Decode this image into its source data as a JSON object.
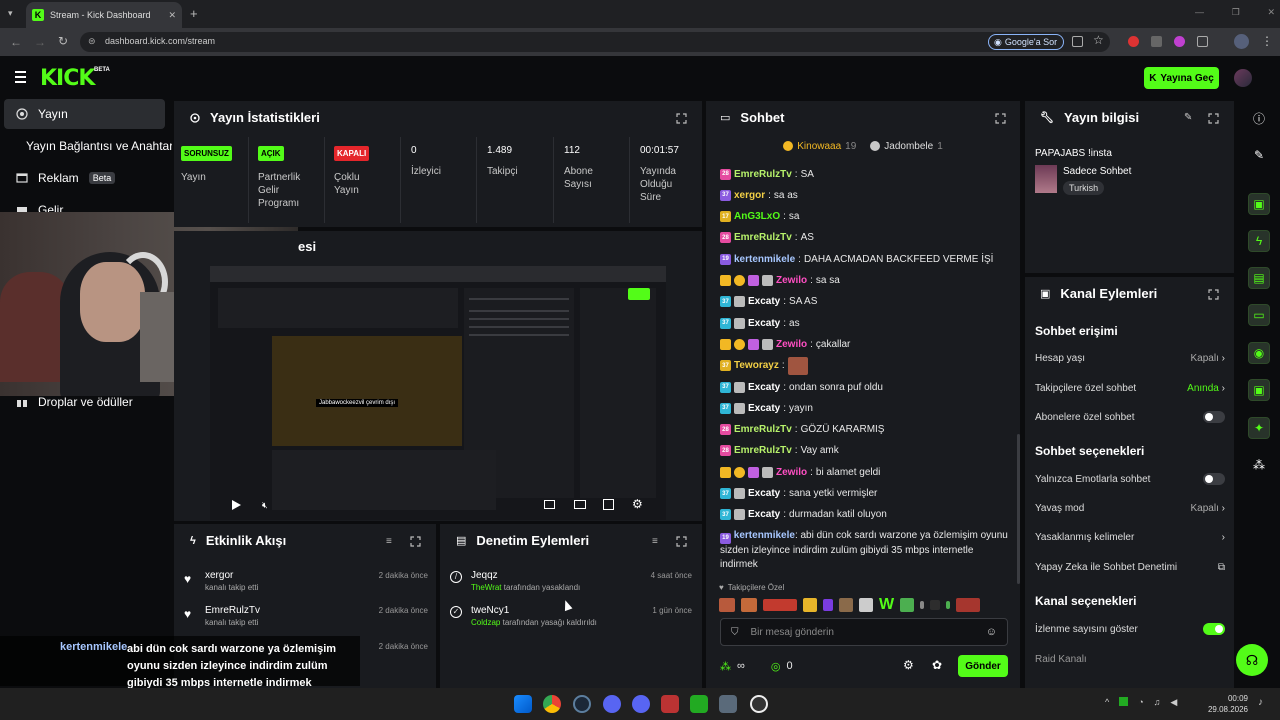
{
  "browser": {
    "tab_title": "Stream - Kick Dashboard",
    "url": "dashboard.kick.com/stream",
    "search_chip": "Google'a Sor"
  },
  "header": {
    "logo": "KICK",
    "logo_badge": "BETA",
    "go_live": "Yayına Geç"
  },
  "sidebar": {
    "items": [
      {
        "label": "Yayın",
        "icon": "broadcast-icon"
      },
      {
        "label": "Yayın Bağlantısı ve Anahtar",
        "icon": "link-icon"
      },
      {
        "label": "Reklam",
        "icon": "ad-icon",
        "badge": "Beta"
      },
      {
        "label": "Gelir",
        "icon": "money-icon"
      },
      {
        "label": "Droplar ve ödüller",
        "icon": "gift-icon"
      }
    ]
  },
  "stats": {
    "title": "Yayın İstatistikleri",
    "items": [
      {
        "badge": "SORUNSUZ",
        "badge_color": "#53fc18",
        "label": "Yayın"
      },
      {
        "badge": "AÇIK",
        "badge_color": "#53fc18",
        "label": "Partnerlik Gelir Programı"
      },
      {
        "badge": "KAPALI",
        "badge_color": "#e5262b",
        "label": "Çoklu Yayın"
      },
      {
        "value": "0",
        "label": "İzleyici"
      },
      {
        "value": "1.489",
        "label": "Takipçi"
      },
      {
        "value": "112",
        "label": "Abone Sayısı"
      },
      {
        "value": "00:01:57",
        "label": "Yayında Olduğu Süre"
      }
    ]
  },
  "preview": {
    "title_suffix": "esi",
    "overlay_caption": "Jabbawockeezvil çevrim dışı"
  },
  "activity": {
    "title": "Etkinlik Akışı",
    "items": [
      {
        "user": "xergor",
        "action": "kanalı takip etti",
        "time": "2 dakika önce"
      },
      {
        "user": "EmreRulzTv",
        "action": "kanalı takip etti",
        "time": "2 dakika önce"
      },
      {
        "user": "",
        "action": "",
        "time": "2 dakika önce"
      }
    ]
  },
  "moderation": {
    "title": "Denetim Eylemleri",
    "items": [
      {
        "user": "Jeqqz",
        "actor": "TheWrat",
        "action": "tarafından yasaklandı",
        "time": "4 saat önce"
      },
      {
        "user": "tweNcy1",
        "actor": "Coldzap",
        "action": "tarafından yasağı kaldırıldı",
        "time": "1 gün önce"
      }
    ]
  },
  "webcam_caption": {
    "user": "kertenmikele",
    "text": "abi dün cok sardı warzone ya özlemişim oyunu sizden izleyince indirdim zulüm gibiydi 35 mbps internetle indirmek"
  },
  "chat": {
    "title": "Sohbet",
    "top_gifters": [
      {
        "name": "Kinowaaa",
        "count": "19"
      },
      {
        "name": "Jadombele",
        "count": "1"
      }
    ],
    "messages": [
      {
        "lv": "28",
        "color": "#e54ba0",
        "user": "EmreRulzTv",
        "ucolor": "#b7f26b",
        "text": "SA"
      },
      {
        "lv": "37",
        "color": "#8a5be0",
        "user": "xergor",
        "ucolor": "#f3d046",
        "text": "sa as"
      },
      {
        "lv": "17",
        "color": "#e0b020",
        "user": "AnG3LxO",
        "ucolor": "#53fc18",
        "text": "sa"
      },
      {
        "lv": "28",
        "color": "#e54ba0",
        "user": "EmreRulzTv",
        "ucolor": "#b7f26b",
        "text": "AS"
      },
      {
        "lv": "19",
        "color": "#8a5be0",
        "user": "kertenmikele",
        "ucolor": "#a7c7ff",
        "text": "DAHA ACMADAN BACKFEED VERME İŞİ"
      },
      {
        "lv": "",
        "color": "",
        "user": "Zewilo",
        "ucolor": "#ff4fc3",
        "text": "sa sa",
        "badges": true
      },
      {
        "lv": "37",
        "color": "#2fb6d6",
        "user": "Excaty",
        "ucolor": "#ffffff",
        "text": "SA AS",
        "mod": true
      },
      {
        "lv": "37",
        "color": "#2fb6d6",
        "user": "Excaty",
        "ucolor": "#ffffff",
        "text": "as",
        "mod": true
      },
      {
        "lv": "",
        "color": "",
        "user": "Zewilo",
        "ucolor": "#ff4fc3",
        "text": "çakallar",
        "badges": true
      },
      {
        "lv": "37",
        "color": "#e0b020",
        "user": "Teworayz",
        "ucolor": "#f3d046",
        "text": "",
        "emote": true
      },
      {
        "lv": "37",
        "color": "#2fb6d6",
        "user": "Excaty",
        "ucolor": "#ffffff",
        "text": "ondan sonra puf oldu",
        "mod": true
      },
      {
        "lv": "37",
        "color": "#2fb6d6",
        "user": "Excaty",
        "ucolor": "#ffffff",
        "text": "yayın",
        "mod": true
      },
      {
        "lv": "28",
        "color": "#e54ba0",
        "user": "EmreRulzTv",
        "ucolor": "#b7f26b",
        "text": "GÖZÜ KARARMIŞ"
      },
      {
        "lv": "28",
        "color": "#e54ba0",
        "user": "EmreRulzTv",
        "ucolor": "#b7f26b",
        "text": "Vay amk"
      },
      {
        "lv": "",
        "color": "",
        "user": "Zewilo",
        "ucolor": "#ff4fc3",
        "text": "bi alamet geldi",
        "badges": true
      },
      {
        "lv": "37",
        "color": "#2fb6d6",
        "user": "Excaty",
        "ucolor": "#ffffff",
        "text": "sana yetki vermişler",
        "mod": true
      },
      {
        "lv": "37",
        "color": "#2fb6d6",
        "user": "Excaty",
        "ucolor": "#ffffff",
        "text": "durmadan katil oluyon",
        "mod": true
      }
    ],
    "last_message": {
      "lv": "19",
      "user": "kertenmikele",
      "text": "abi dün cok sardı warzone ya özlemişim oyunu sizden izleyince indirdim zulüm gibiydi 35 mbps internetle indirmek"
    },
    "emote_bar_label": "Takipçilere Özel",
    "input_placeholder": "Bir mesaj gönderin",
    "footer_left": "∞",
    "footer_points": "0",
    "send": "Gönder"
  },
  "stream_info": {
    "title": "Yayın bilgisi",
    "stream_title": "PAPAJABS !insta",
    "category": "Sadece Sohbet",
    "tag": "Turkish"
  },
  "channel_actions": {
    "title": "Kanal Eylemleri",
    "section_access": "Sohbet erişimi",
    "rows_access": [
      {
        "label": "Hesap yaşı",
        "value": "Kapalı",
        "type": "chevron"
      },
      {
        "label": "Takipçilere özel sohbet",
        "value": "Anında",
        "type": "chevron",
        "value_color": "#53fc18"
      },
      {
        "label": "Abonelere özel sohbet",
        "value": "",
        "type": "toggle",
        "on": false
      }
    ],
    "section_options": "Sohbet seçenekleri",
    "rows_options": [
      {
        "label": "Yalnızca Emotlarla sohbet",
        "value": "",
        "type": "toggle",
        "on": false
      },
      {
        "label": "Yavaş mod",
        "value": "Kapalı",
        "type": "chevron"
      },
      {
        "label": "Yasaklanmış kelimeler",
        "value": "",
        "type": "chevron"
      },
      {
        "label": "Yapay Zeka ile Sohbet Denetimi",
        "value": "",
        "type": "external"
      }
    ],
    "section_channel": "Kanal seçenekleri",
    "rows_channel": [
      {
        "label": "İzlenme sayısını göster",
        "value": "",
        "type": "toggle",
        "on": true
      },
      {
        "label": "Raid Kanalı",
        "value": "",
        "type": "none"
      }
    ]
  },
  "taskbar": {
    "time": "00:09",
    "date": "29.08.2026"
  },
  "colors": {
    "accent": "#53fc18",
    "panel": "#191b1f",
    "background": "#0b0c0e"
  }
}
